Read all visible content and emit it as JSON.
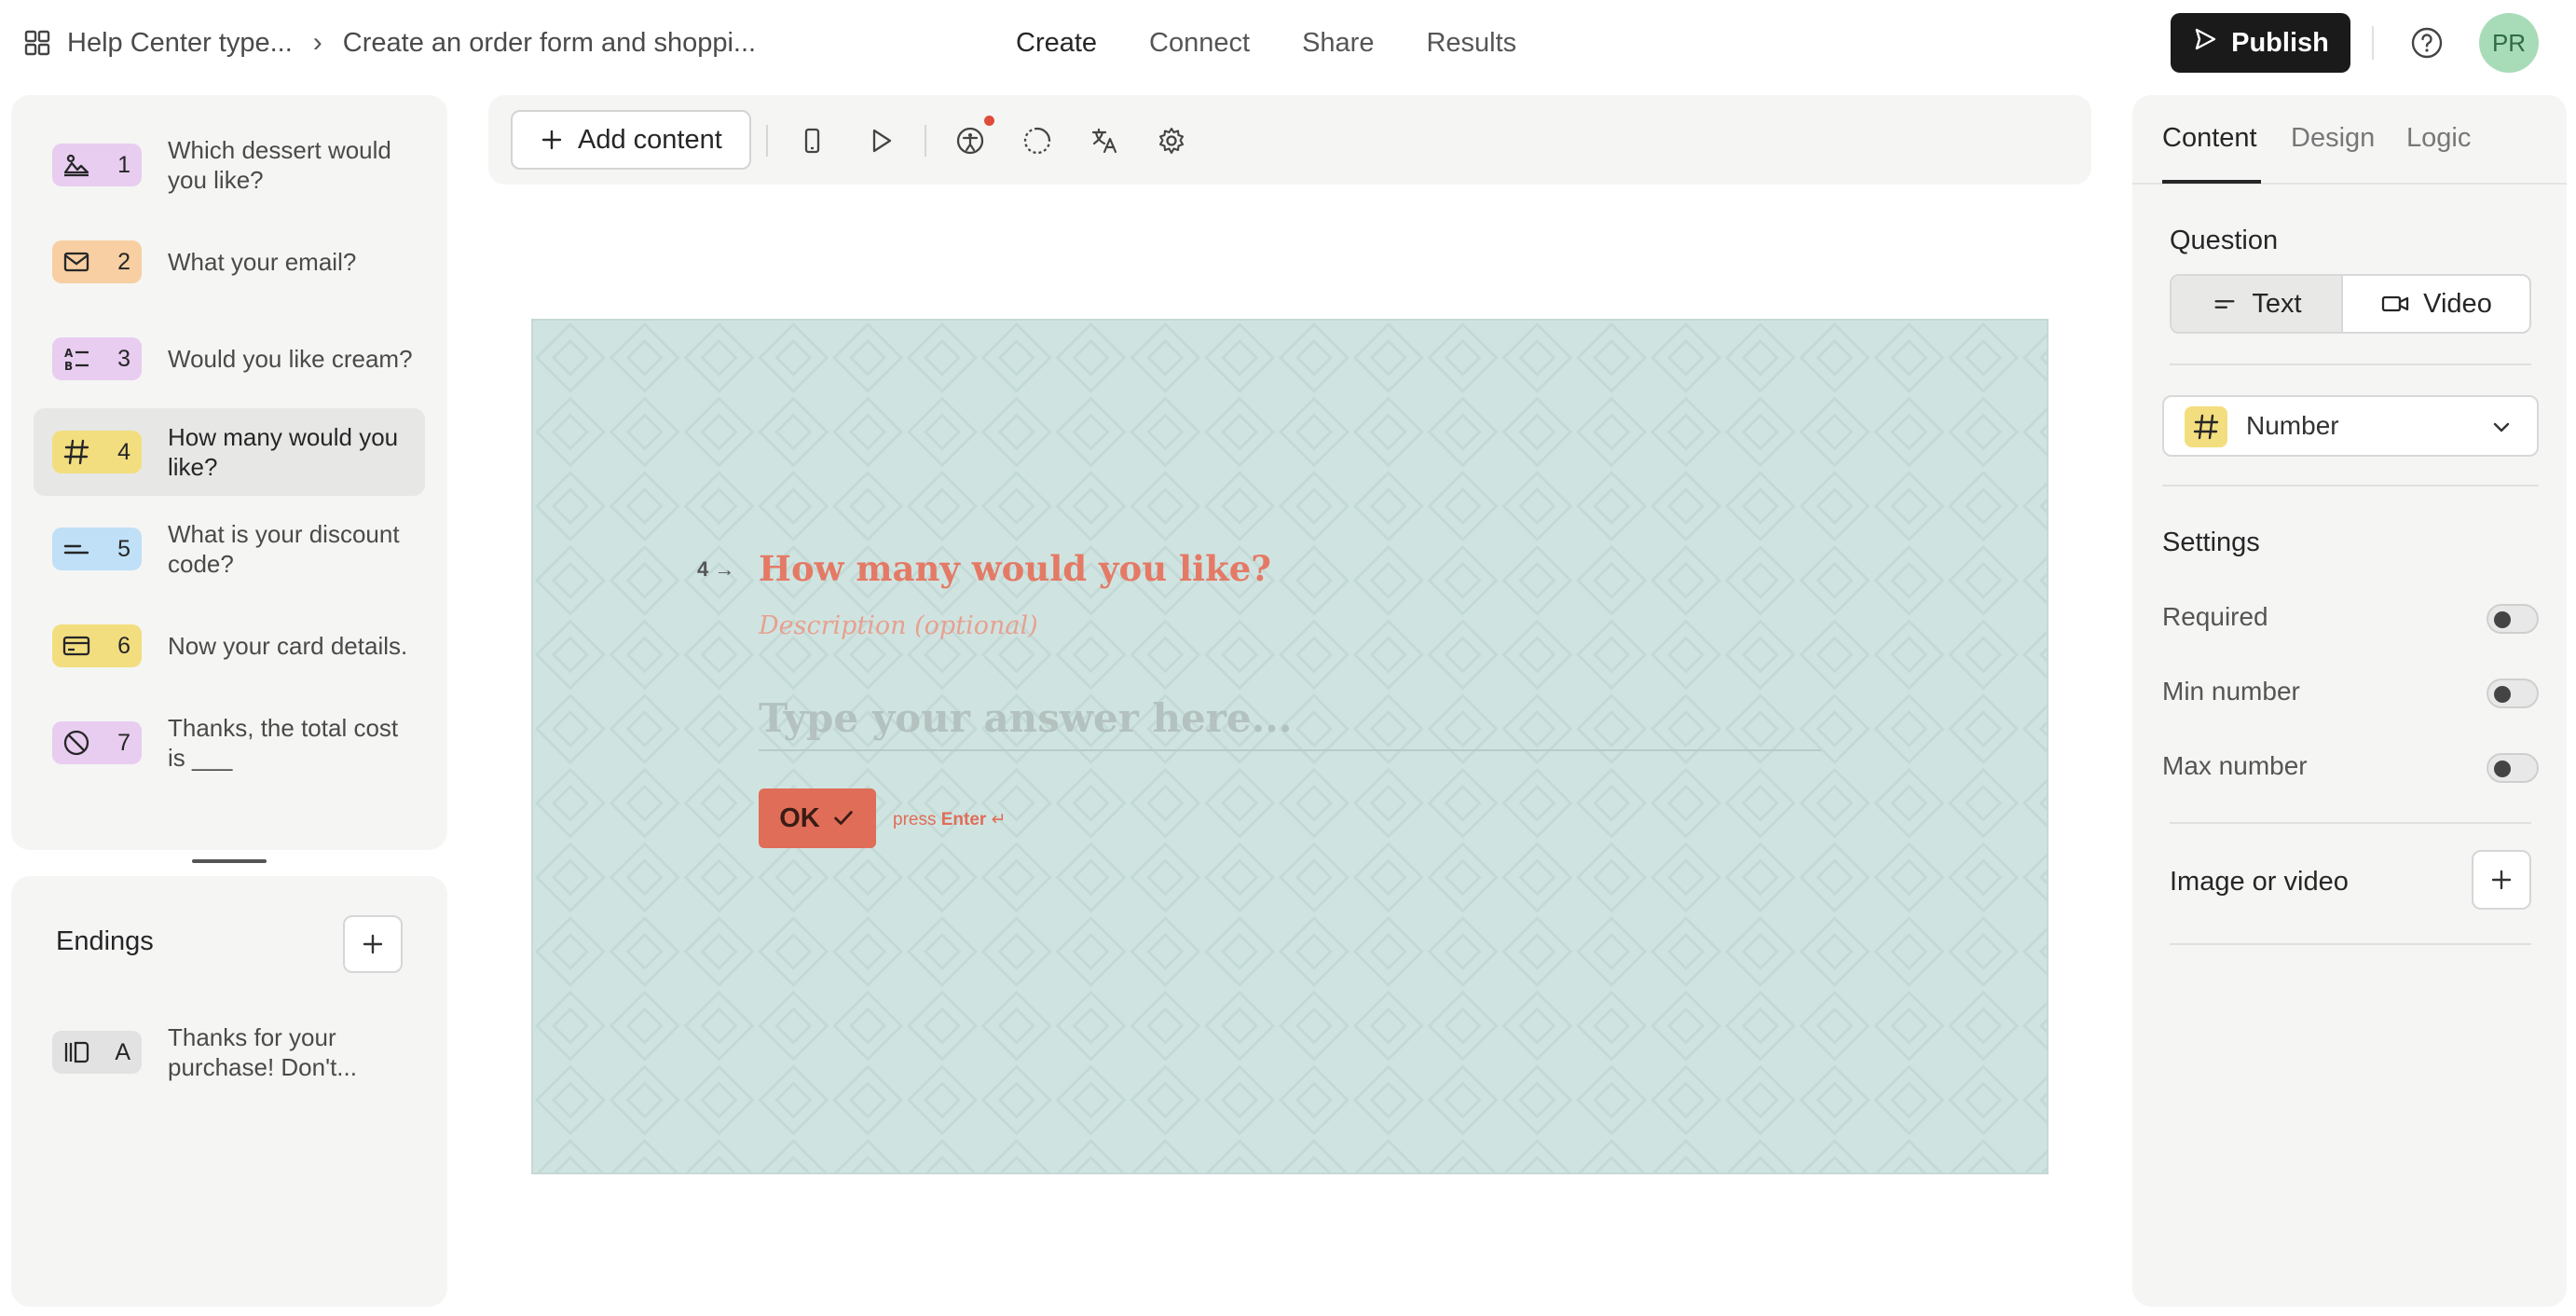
{
  "header": {
    "breadcrumb_root": "Help Center type...",
    "breadcrumb_form": "Create an order form and shoppi...",
    "nav": [
      "Create",
      "Connect",
      "Share",
      "Results"
    ],
    "active_nav": "Create",
    "publish_label": "Publish",
    "avatar_initials": "PR"
  },
  "questions": [
    {
      "number": "1",
      "label": "Which dessert would you like?",
      "icon": "image-icon",
      "color": "#e8cdf0"
    },
    {
      "number": "2",
      "label": "What your email?",
      "icon": "mail-icon",
      "color": "#f7cfa2"
    },
    {
      "number": "3",
      "label": "Would you like cream?",
      "icon": "multiple-choice-icon",
      "color": "#e8cdf0"
    },
    {
      "number": "4",
      "label": "How many would you like?",
      "icon": "hash-icon",
      "color": "#f2de7f"
    },
    {
      "number": "5",
      "label": "What is your discount code?",
      "icon": "short-text-icon",
      "color": "#bfe0f7"
    },
    {
      "number": "6",
      "label": "Now your card details.",
      "icon": "credit-card-icon",
      "color": "#f2de7f"
    },
    {
      "number": "7",
      "label": "Thanks, the total cost is ___",
      "icon": "statement-icon",
      "color": "#e8cdf0"
    }
  ],
  "active_question": "4",
  "endings": {
    "title": "Endings",
    "items": [
      {
        "letter": "A",
        "label": "Thanks for your purchase! Don't...",
        "icon": "ending-icon",
        "color": "#e2e2e2"
      }
    ]
  },
  "toolbar": {
    "add_content_label": "Add content"
  },
  "preview": {
    "question_number": "4",
    "question_title": "How many would you like?",
    "description_placeholder": "Description (optional)",
    "answer_placeholder": "Type your answer here...",
    "ok_label": "OK",
    "press_prefix": "press",
    "press_key": "Enter",
    "background_color": "#cfe4e1",
    "accent_color": "#e06d58"
  },
  "right_panel": {
    "tabs": [
      "Content",
      "Design",
      "Logic"
    ],
    "active_tab": "Content",
    "question_label": "Question",
    "question_modes": [
      "Text",
      "Video"
    ],
    "selected_mode": "Text",
    "question_type": "Number",
    "settings_label": "Settings",
    "settings": [
      {
        "label": "Required",
        "enabled": false
      },
      {
        "label": "Min number",
        "enabled": false
      },
      {
        "label": "Max number",
        "enabled": false
      }
    ],
    "image_or_video_label": "Image or video"
  }
}
